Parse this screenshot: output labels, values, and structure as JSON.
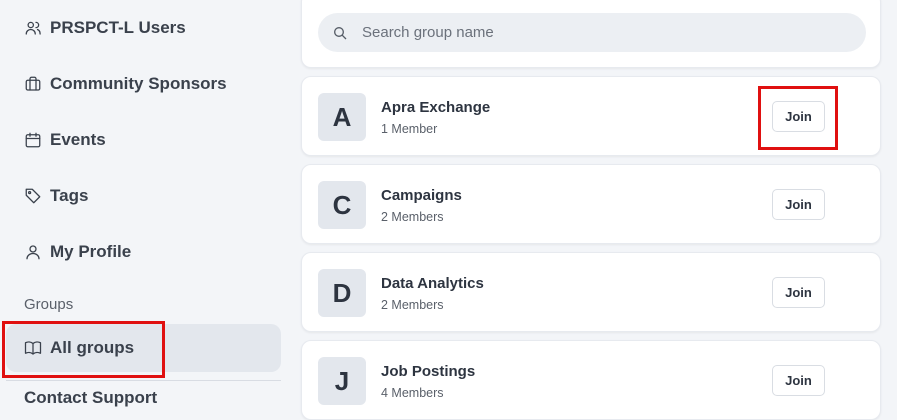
{
  "sidebar": {
    "items": [
      {
        "label": "PRSPCT-L Users",
        "icon": "users-icon"
      },
      {
        "label": "Community Sponsors",
        "icon": "briefcase-icon"
      },
      {
        "label": "Events",
        "icon": "calendar-icon"
      },
      {
        "label": "Tags",
        "icon": "tag-icon"
      },
      {
        "label": "My Profile",
        "icon": "user-icon"
      }
    ],
    "section_label": "Groups",
    "active_item": {
      "label": "All groups",
      "icon": "book-open-icon"
    },
    "cut_item": {
      "label": "Contact Support"
    }
  },
  "search": {
    "placeholder": "Search group name"
  },
  "groups": [
    {
      "initial": "A",
      "name": "Apra Exchange",
      "members": "1 Member",
      "action": "Join"
    },
    {
      "initial": "C",
      "name": "Campaigns",
      "members": "2 Members",
      "action": "Join"
    },
    {
      "initial": "D",
      "name": "Data Analytics",
      "members": "2 Members",
      "action": "Join"
    },
    {
      "initial": "J",
      "name": "Job Postings",
      "members": "4 Members",
      "action": "Join"
    }
  ],
  "colors": {
    "highlight": "#e01010",
    "active_bg": "#e3e7ed",
    "page_bg": "#f3f5f8"
  }
}
